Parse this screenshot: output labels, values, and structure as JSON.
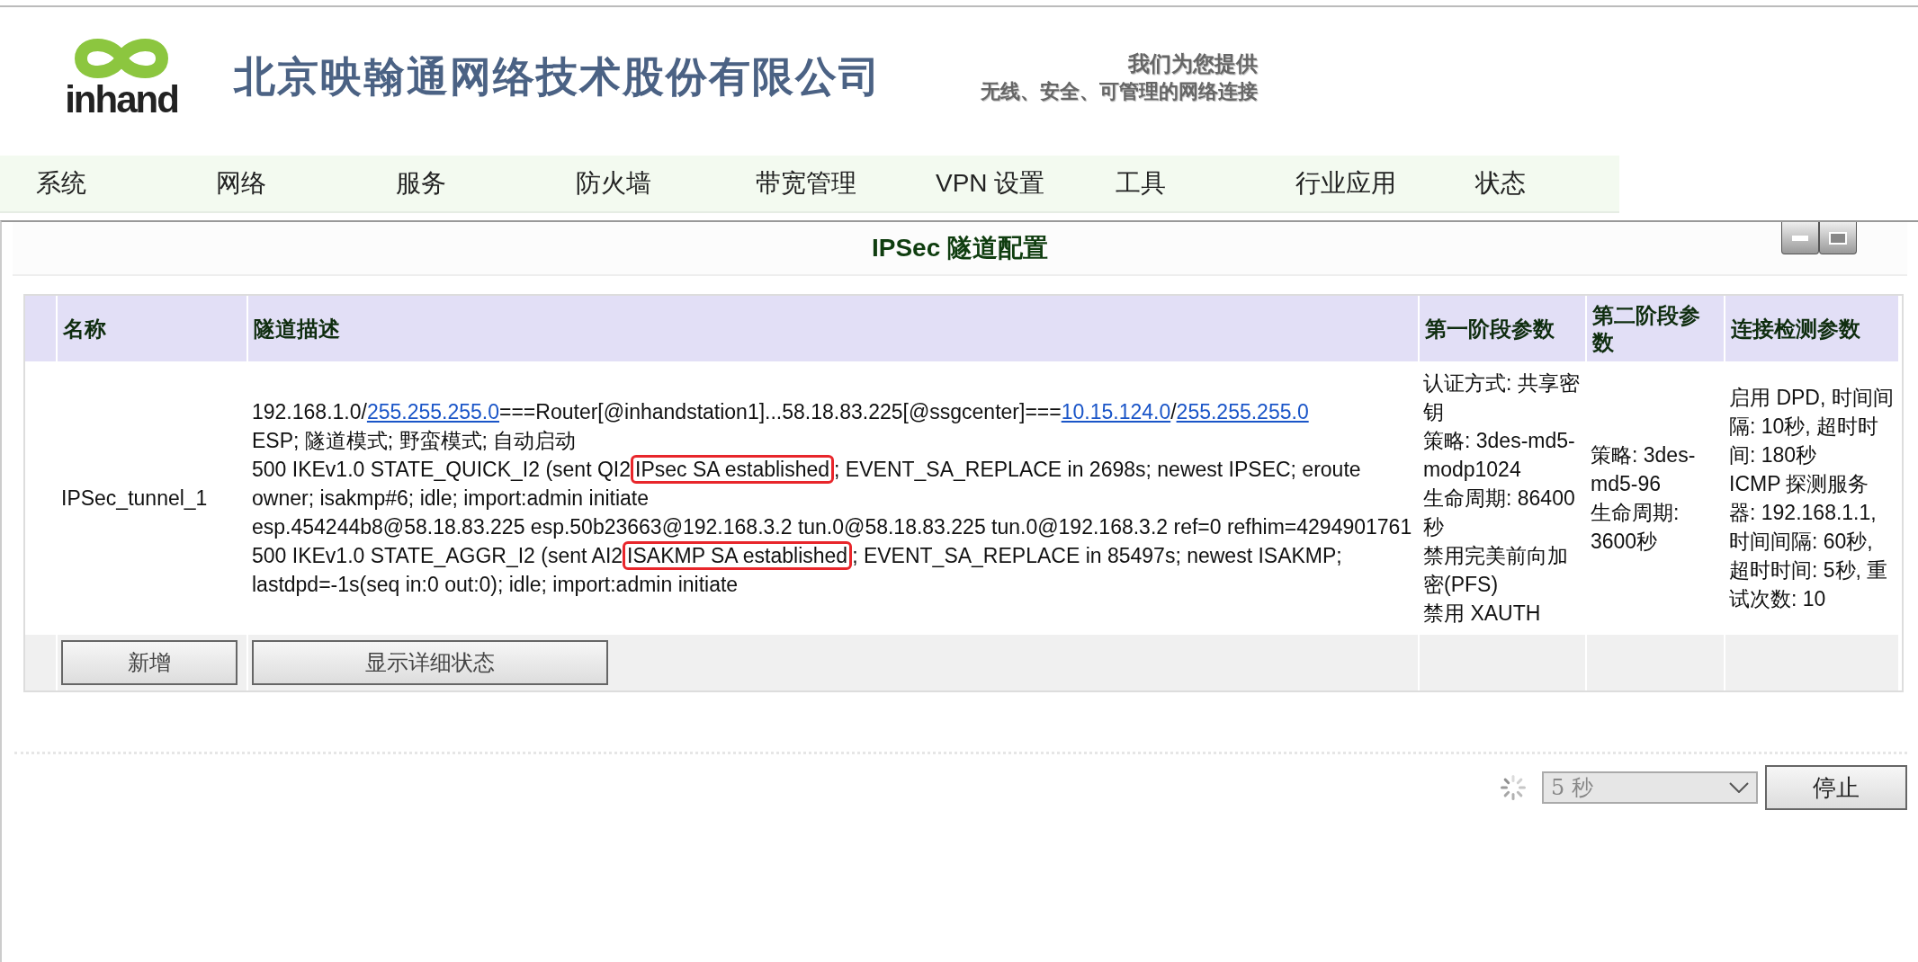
{
  "header": {
    "logo_text": "inhand",
    "company": "北京映翰通网络技术股份有限公司",
    "slogan": [
      "我们为您提供",
      "无线、安全、可管理的网络连接"
    ]
  },
  "nav": [
    "系统",
    "网络",
    "服务",
    "防火墙",
    "带宽管理",
    "VPN 设置",
    "工具",
    "行业应用",
    "状态"
  ],
  "panel": {
    "title": "IPSec 隧道配置",
    "table": {
      "columns": [
        "名称",
        "隧道描述",
        "第一阶段参数",
        "第二阶段参数",
        "连接检测参数"
      ],
      "rows": [
        {
          "name": "IPSec_tunnel_1",
          "description": [
            [
              {
                "kind": "plain",
                "text": "192.168.1.0/"
              },
              {
                "kind": "link",
                "text": "255.255.255.0"
              },
              {
                "kind": "plain",
                "text": "===Router[@inhandstation1]...58.18.83.225[@ssgcenter]==="
              },
              {
                "kind": "link",
                "text": "10.15.124.0"
              },
              {
                "kind": "plain",
                "text": "/"
              },
              {
                "kind": "link",
                "text": "255.255.255.0"
              }
            ],
            [
              {
                "kind": "plain",
                "text": "ESP; 隧道模式; 野蛮模式; 自动启动"
              }
            ],
            [
              {
                "kind": "plain",
                "text": "500 IKEv1.0 STATE_QUICK_I2 (sent QI2"
              },
              {
                "kind": "highlight",
                "text": "IPsec SA established"
              },
              {
                "kind": "plain",
                "text": "; EVENT_SA_REPLACE in 2698s; newest IPSEC; eroute owner; isakmp#6; idle; import:admin initiate"
              }
            ],
            [
              {
                "kind": "plain",
                "text": "esp.454244b8@58.18.83.225 esp.50b23663@192.168.3.2 tun.0@58.18.83.225 tun.0@192.168.3.2 ref=0 refhim=4294901761"
              }
            ],
            [
              {
                "kind": "plain",
                "text": "500 IKEv1.0 STATE_AGGR_I2 (sent AI2"
              },
              {
                "kind": "highlight",
                "text": "ISAKMP SA established"
              },
              {
                "kind": "plain",
                "text": "; EVENT_SA_REPLACE in 85497s; newest ISAKMP; lastdpd=-1s(seq in:0 out:0); idle; import:admin initiate"
              }
            ]
          ],
          "phase1": [
            "认证方式: 共享密钥",
            "策略: 3des-md5-modp1024",
            "生命周期: 86400秒",
            "禁用完美前向加密(PFS)",
            "禁用 XAUTH"
          ],
          "phase2": [
            "策略: 3des-md5-96",
            "生命周期: 3600秒"
          ],
          "detection": [
            "启用 DPD, 时间间隔: 10秒, 超时时间: 180秒",
            "ICMP 探测服务器: 192.168.1.1, 时间间隔: 60秒, 超时时间: 5秒, 重试次数: 10"
          ]
        }
      ],
      "buttons": [
        "新增",
        "显示详细状态"
      ]
    }
  },
  "refresh": {
    "interval": "5 秒",
    "button": "停止"
  }
}
